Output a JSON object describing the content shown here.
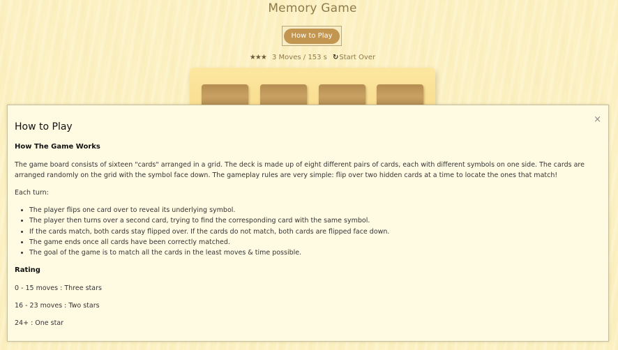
{
  "game": {
    "title": "Memory Game",
    "how_to_play_button": "How to Play",
    "stars": "★★★",
    "stars_count": 3,
    "moves_text": "3 Moves",
    "separator": "/",
    "time_text": "153 s",
    "restart_icon": "↻",
    "restart_label": "Start Over"
  },
  "modal": {
    "close_glyph": "×",
    "title": "How to Play",
    "section1_heading": "How The Game Works",
    "section1_text": "The game board consists of sixteen \"cards\" arranged in a grid. The deck is made up of eight different pairs of cards, each with different symbols on one side. The cards are arranged randomly on the grid with the symbol face down. The gameplay rules are very simple: flip over two hidden cards at a time to locate the ones that match!",
    "each_turn_label": "Each turn:",
    "rules": [
      "The player flips one card over to reveal its underlying symbol.",
      "The player then turns over a second card, trying to find the corresponding card with the same symbol.",
      "If the cards match, both cards stay flipped over. If the cards do not match, both cards are flipped face down.",
      "The game ends once all cards have been correctly matched.",
      "The goal of the game is to match all the cards in the least moves & time possible."
    ],
    "rating_heading": "Rating",
    "rating_lines": [
      "0 - 15 moves : Three stars",
      "16 - 23 moves : Two stars",
      "24+ : One star"
    ]
  },
  "colors": {
    "background": "#fdf2c4",
    "accent_button": "#c29551",
    "card_back": "#b48d52",
    "deck": "#f8d98a",
    "title_text": "#8f7a4c"
  }
}
